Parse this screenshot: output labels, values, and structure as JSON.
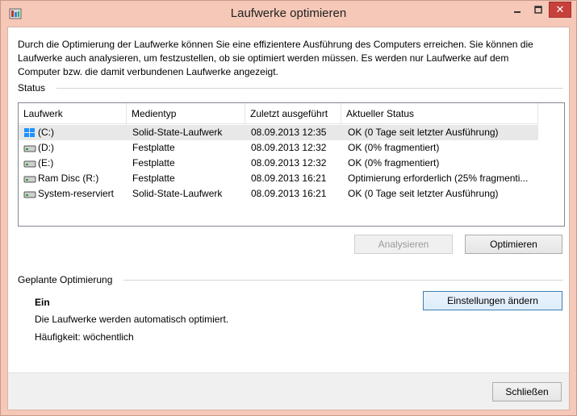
{
  "window": {
    "title": "Laufwerke optimieren",
    "close_glyph": "✕",
    "minimize_glyph": "—"
  },
  "intro_text": "Durch die Optimierung der Laufwerke können Sie eine effizientere Ausführung des Computers erreichen. Sie können die Laufwerke auch analysieren, um festzustellen, ob sie optimiert werden müssen. Es werden nur Laufwerke auf dem Computer bzw. die damit verbundenen Laufwerke angezeigt.",
  "status": {
    "label": "Status",
    "columns": [
      "Laufwerk",
      "Medientyp",
      "Zuletzt ausgeführt",
      "Aktueller Status"
    ],
    "rows": [
      {
        "drive": "(C:)",
        "icon": "windows-drive-icon",
        "media": "Solid-State-Laufwerk",
        "last_run": "08.09.2013 12:35",
        "state": "OK (0 Tage seit letzter Ausführung)",
        "selected": true
      },
      {
        "drive": "(D:)",
        "icon": "hard-disk-icon",
        "media": "Festplatte",
        "last_run": "08.09.2013 12:32",
        "state": "OK (0% fragmentiert)",
        "selected": false
      },
      {
        "drive": "(E:)",
        "icon": "hard-disk-icon",
        "media": "Festplatte",
        "last_run": "08.09.2013 12:32",
        "state": "OK (0% fragmentiert)",
        "selected": false
      },
      {
        "drive": "Ram Disc (R:)",
        "icon": "hard-disk-icon",
        "media": "Festplatte",
        "last_run": "08.09.2013 16:21",
        "state": "Optimierung erforderlich (25% fragmenti...",
        "selected": false
      },
      {
        "drive": "System-reserviert",
        "icon": "hard-disk-icon",
        "media": "Solid-State-Laufwerk",
        "last_run": "08.09.2013 16:21",
        "state": "OK (0 Tage seit letzter Ausführung)",
        "selected": false
      }
    ],
    "analyze_label": "Analysieren",
    "optimize_label": "Optimieren"
  },
  "scheduled": {
    "label": "Geplante Optimierung",
    "state": "Ein",
    "description": "Die Laufwerke werden automatisch optimiert.",
    "frequency": "Häufigkeit: wöchentlich",
    "change_settings_label": "Einstellungen ändern"
  },
  "footer": {
    "close_label": "Schließen"
  }
}
